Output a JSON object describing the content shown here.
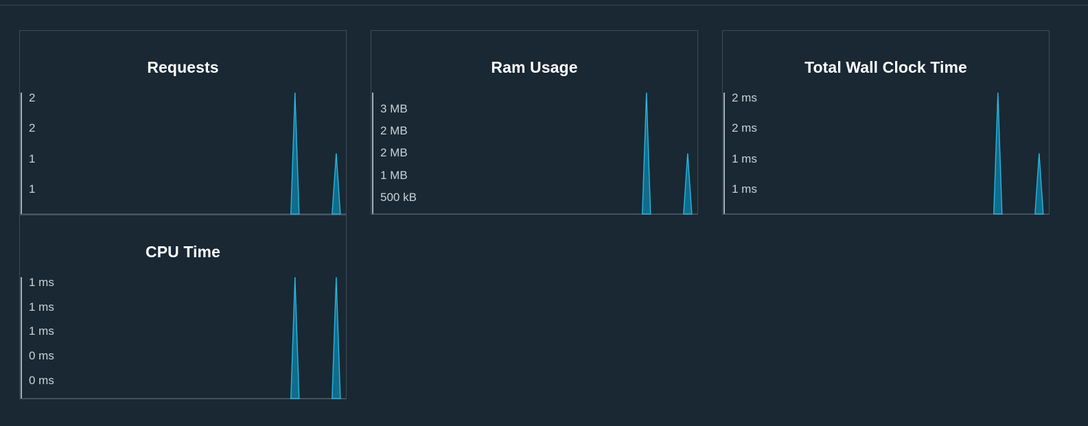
{
  "accent_color": "#29b6df",
  "panels": [
    {
      "id": "requests",
      "title": "Requests",
      "chart_data": {
        "type": "line",
        "title": "Requests",
        "y_tick_labels": [
          "2",
          "2",
          "1",
          "1"
        ],
        "ylim": [
          0,
          2
        ],
        "spikes": [
          {
            "x": 0.843,
            "y": 2
          },
          {
            "x": 0.97,
            "y": 1
          }
        ]
      }
    },
    {
      "id": "ram-usage",
      "title": "Ram Usage",
      "chart_data": {
        "type": "line",
        "title": "Ram Usage",
        "y_tick_labels": [
          "3 MB",
          "2 MB",
          "2 MB",
          "1 MB",
          "500 kB"
        ],
        "ylim": [
          0,
          3
        ],
        "spikes": [
          {
            "x": 0.843,
            "y": 3
          },
          {
            "x": 0.97,
            "y": 1.5
          }
        ]
      }
    },
    {
      "id": "total-wall-clock-time",
      "title": "Total Wall Clock Time",
      "chart_data": {
        "type": "line",
        "title": "Total Wall Clock Time",
        "y_tick_labels": [
          "2 ms",
          "2 ms",
          "1 ms",
          "1 ms"
        ],
        "ylim": [
          0,
          2
        ],
        "spikes": [
          {
            "x": 0.843,
            "y": 2
          },
          {
            "x": 0.97,
            "y": 1
          }
        ]
      }
    },
    {
      "id": "cpu-time",
      "title": "CPU Time",
      "chart_data": {
        "type": "line",
        "title": "CPU Time",
        "y_tick_labels": [
          "1 ms",
          "1 ms",
          "1 ms",
          "0 ms",
          "0 ms"
        ],
        "ylim": [
          0,
          1
        ],
        "spikes": [
          {
            "x": 0.843,
            "y": 1
          },
          {
            "x": 0.97,
            "y": 1
          }
        ]
      }
    }
  ]
}
